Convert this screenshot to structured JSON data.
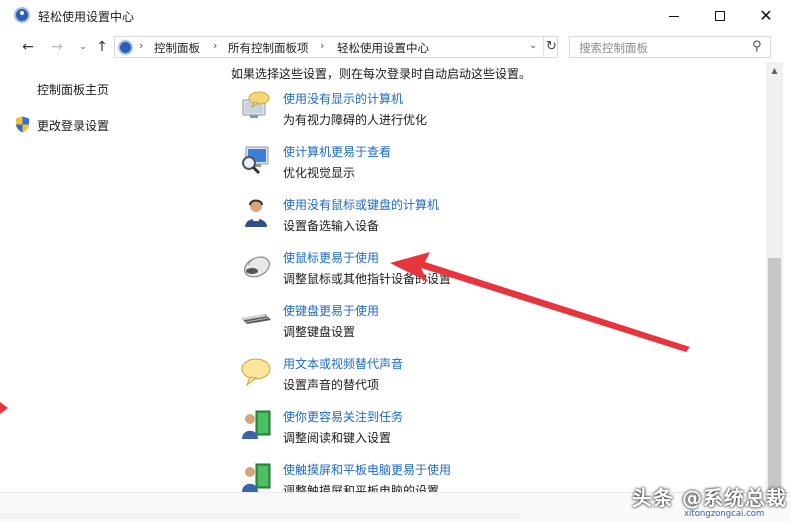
{
  "window": {
    "title": "轻松使用设置中心",
    "icon": "ease-of-access-center-icon",
    "controls": {
      "minimize": "minimize-icon",
      "maximize": "maximize-icon",
      "close": "close-icon"
    }
  },
  "navigation": {
    "back": "←",
    "forward": "→",
    "recent": "⌄",
    "up": "↑",
    "breadcrumbs": [
      "控制面板",
      "所有控制面板项",
      "轻松使用设置中心"
    ],
    "separator": "›",
    "dropdown": "⌄",
    "refresh": "↻"
  },
  "search": {
    "placeholder": "搜索控制面板",
    "icon": "search-icon"
  },
  "sidebar": {
    "items": [
      {
        "label": "控制面板主页"
      },
      {
        "label": "更改登录设置",
        "icon": "shield-icon"
      }
    ]
  },
  "main": {
    "intro": "如果选择这些设置，则在每次登录时自动启动这些设置。",
    "items": [
      {
        "link": "使用没有显示的计算机",
        "desc": "为有视力障碍的人进行优化",
        "icon": "speech-monitor-icon"
      },
      {
        "link": "使计算机更易于查看",
        "desc": "优化视觉显示",
        "icon": "magnifier-monitor-icon"
      },
      {
        "link": "使用没有鼠标或键盘的计算机",
        "desc": "设置备选输入设备",
        "icon": "person-headset-icon"
      },
      {
        "link": "使鼠标更易于使用",
        "desc": "调整鼠标或其他指针设备的设置",
        "icon": "mouse-icon"
      },
      {
        "link": "使键盘更易于使用",
        "desc": "调整键盘设置",
        "icon": "keyboard-icon"
      },
      {
        "link": "用文本或视频替代声音",
        "desc": "设置声音的替代项",
        "icon": "speech-bubble-icon"
      },
      {
        "link": "使你更容易关注到任务",
        "desc": "调整阅读和键入设置",
        "icon": "person-book-icon"
      },
      {
        "link": "使触摸屏和平板电脑更易于使用",
        "desc": "调整触摸屏和平板电脑的设置",
        "icon": "person-tablet-icon"
      }
    ]
  },
  "watermark": {
    "text": "头条 @系统总裁",
    "url": "xitongzongcai.com"
  },
  "colors": {
    "link": "#1b6ac9",
    "annotation_arrow": "#e8343c",
    "accent": "#2b5fb4"
  }
}
